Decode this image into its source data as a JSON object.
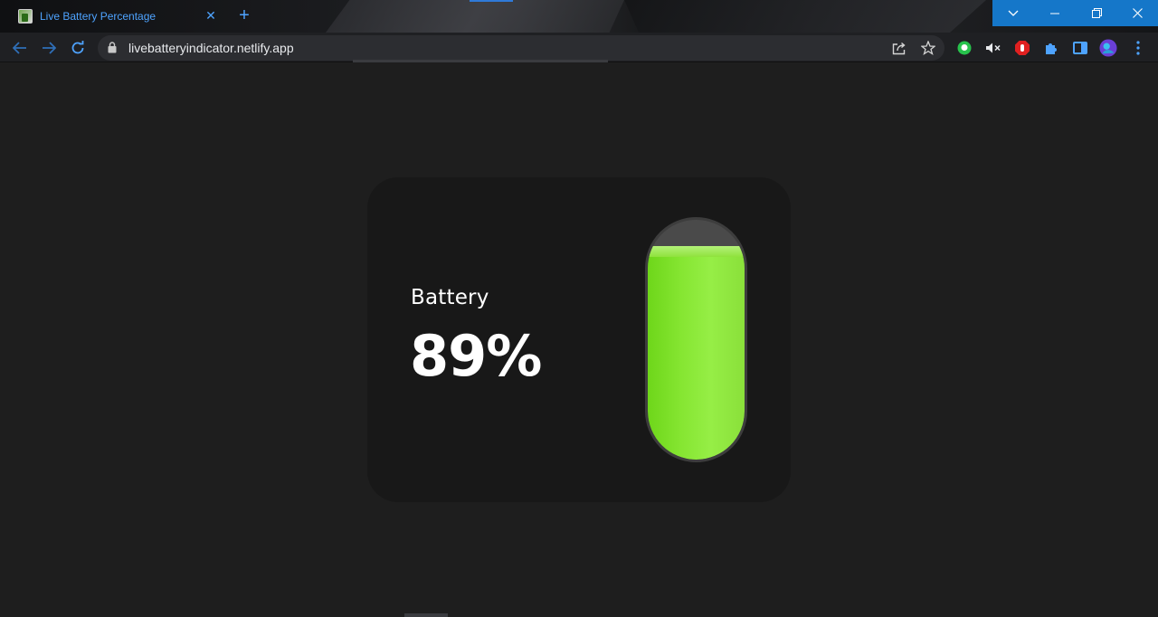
{
  "browser": {
    "tab_title": "Live Battery Percentage",
    "tab_close_icon": "close-icon",
    "new_tab_icon": "plus-icon",
    "url": "livebatteryindicator.netlify.app",
    "window_controls": [
      "chevron-down-icon",
      "minimize-icon",
      "restore-icon",
      "close-icon"
    ],
    "extensions": [
      "chat-extension-icon",
      "mute-icon",
      "adblock-icon",
      "puzzle-icon",
      "sidepanel-icon",
      "avatar",
      "kebab-menu-icon"
    ]
  },
  "battery": {
    "label": "Battery",
    "percent_text": "89%",
    "level": 0.89,
    "fill_color": "#86e632"
  },
  "colors": {
    "accent": "#4ea3ff",
    "window_controls_bg": "#1577c9",
    "page_bg": "#1e1e1e",
    "card_bg": "#181818"
  }
}
